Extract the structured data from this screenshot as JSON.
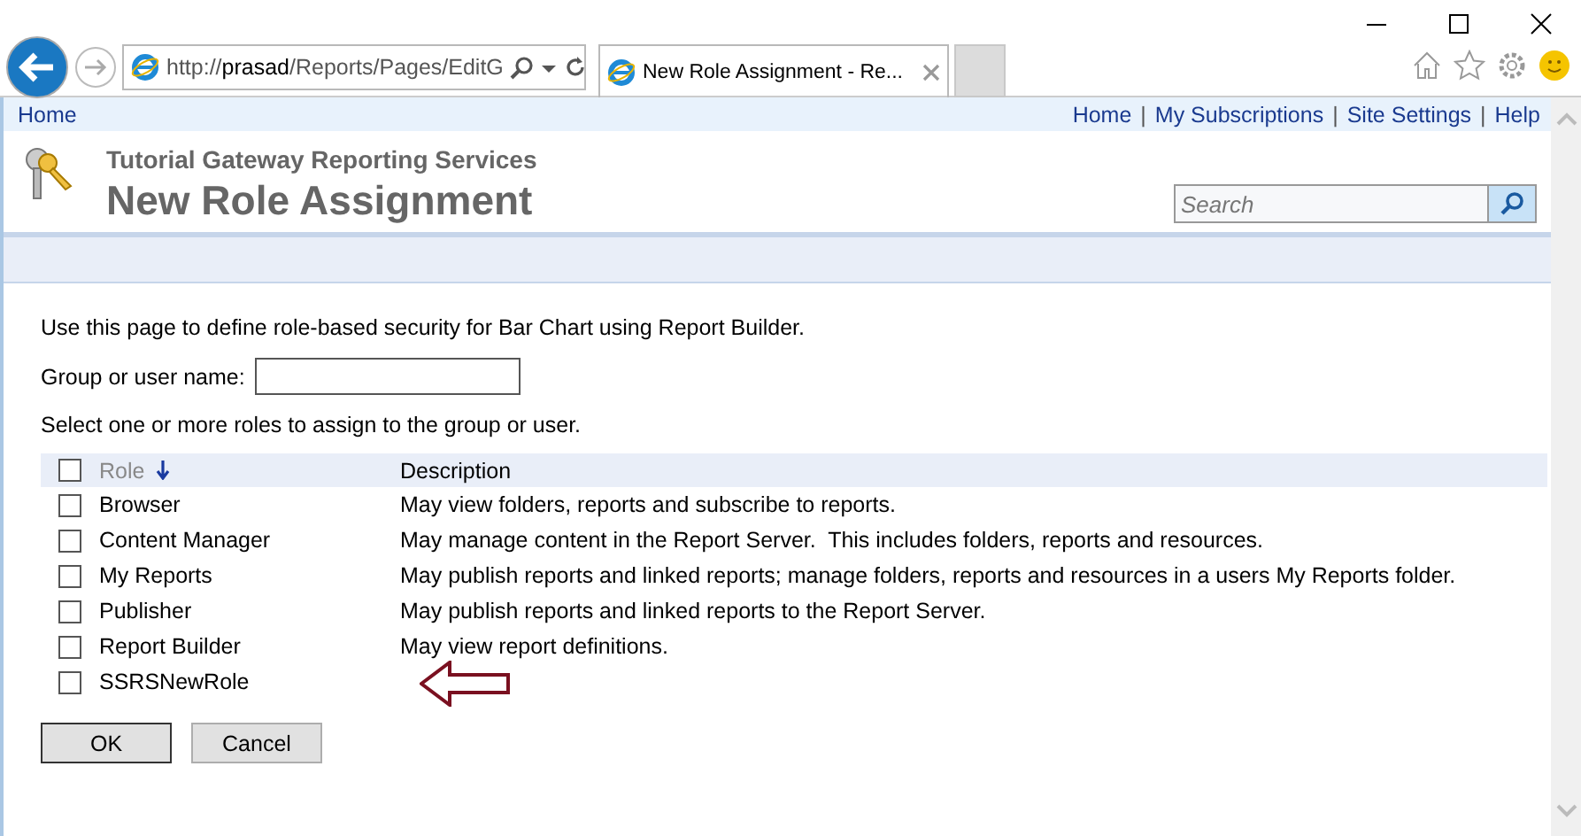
{
  "browser": {
    "address": "http://**prasad**/Reports/Pages/EditG",
    "tab_title": "New Role Assignment - Re..."
  },
  "top_bar": {
    "left_link": "Home",
    "right_links": [
      {
        "kind": "link",
        "text": "Home"
      },
      {
        "kind": "separator",
        "text": "|"
      },
      {
        "kind": "link",
        "text": "My Subscriptions"
      },
      {
        "kind": "separator",
        "text": "|"
      },
      {
        "kind": "link",
        "text": "Site Settings"
      },
      {
        "kind": "separator",
        "text": "|"
      },
      {
        "kind": "link",
        "text": "Help"
      }
    ]
  },
  "header": {
    "site_title": "Tutorial Gateway Reporting Services",
    "page_title": "New Role Assignment",
    "search": {
      "placeholder": "Search"
    }
  },
  "content": {
    "intro": "Use this page to define role-based security for Bar Chart using Report Builder.",
    "group_label": "Group or user name:",
    "instruction": "Select one or more roles to assign to the group or user.",
    "table": {
      "select_all_checked": false,
      "columns": [
        "Role",
        "Description"
      ],
      "rows": [
        {
          "role": "Browser",
          "description": "May view folders, reports and subscribe to reports.",
          "checked": false
        },
        {
          "role": "Content Manager",
          "description": "May manage content in the Report Server.  This includes folders, reports and resources.",
          "checked": false
        },
        {
          "role": "My Reports",
          "description": "May publish reports and linked reports; manage folders, reports and resources in a users My Reports folder.",
          "checked": false
        },
        {
          "role": "Publisher",
          "description": "May publish reports and linked reports to the Report Server.",
          "checked": false
        },
        {
          "role": "Report Builder",
          "description": "May view report definitions.",
          "checked": false
        },
        {
          "role": "SSRSNewRole",
          "description": "",
          "checked": false
        }
      ]
    },
    "buttons": [
      "OK",
      "Cancel"
    ]
  }
}
